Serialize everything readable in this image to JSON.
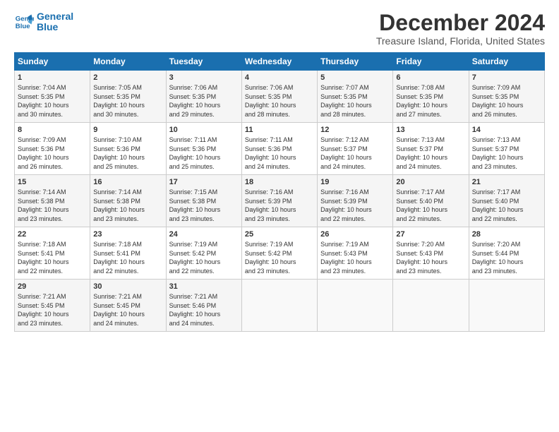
{
  "logo": {
    "line1": "General",
    "line2": "Blue"
  },
  "title": "December 2024",
  "subtitle": "Treasure Island, Florida, United States",
  "headers": [
    "Sunday",
    "Monday",
    "Tuesday",
    "Wednesday",
    "Thursday",
    "Friday",
    "Saturday"
  ],
  "weeks": [
    [
      {
        "day": "1",
        "sunrise": "7:04 AM",
        "sunset": "5:35 PM",
        "daylight": "10 hours and 30 minutes."
      },
      {
        "day": "2",
        "sunrise": "7:05 AM",
        "sunset": "5:35 PM",
        "daylight": "10 hours and 30 minutes."
      },
      {
        "day": "3",
        "sunrise": "7:06 AM",
        "sunset": "5:35 PM",
        "daylight": "10 hours and 29 minutes."
      },
      {
        "day": "4",
        "sunrise": "7:06 AM",
        "sunset": "5:35 PM",
        "daylight": "10 hours and 28 minutes."
      },
      {
        "day": "5",
        "sunrise": "7:07 AM",
        "sunset": "5:35 PM",
        "daylight": "10 hours and 28 minutes."
      },
      {
        "day": "6",
        "sunrise": "7:08 AM",
        "sunset": "5:35 PM",
        "daylight": "10 hours and 27 minutes."
      },
      {
        "day": "7",
        "sunrise": "7:09 AM",
        "sunset": "5:35 PM",
        "daylight": "10 hours and 26 minutes."
      }
    ],
    [
      {
        "day": "8",
        "sunrise": "7:09 AM",
        "sunset": "5:36 PM",
        "daylight": "10 hours and 26 minutes."
      },
      {
        "day": "9",
        "sunrise": "7:10 AM",
        "sunset": "5:36 PM",
        "daylight": "10 hours and 25 minutes."
      },
      {
        "day": "10",
        "sunrise": "7:11 AM",
        "sunset": "5:36 PM",
        "daylight": "10 hours and 25 minutes."
      },
      {
        "day": "11",
        "sunrise": "7:11 AM",
        "sunset": "5:36 PM",
        "daylight": "10 hours and 24 minutes."
      },
      {
        "day": "12",
        "sunrise": "7:12 AM",
        "sunset": "5:37 PM",
        "daylight": "10 hours and 24 minutes."
      },
      {
        "day": "13",
        "sunrise": "7:13 AM",
        "sunset": "5:37 PM",
        "daylight": "10 hours and 24 minutes."
      },
      {
        "day": "14",
        "sunrise": "7:13 AM",
        "sunset": "5:37 PM",
        "daylight": "10 hours and 23 minutes."
      }
    ],
    [
      {
        "day": "15",
        "sunrise": "7:14 AM",
        "sunset": "5:38 PM",
        "daylight": "10 hours and 23 minutes."
      },
      {
        "day": "16",
        "sunrise": "7:14 AM",
        "sunset": "5:38 PM",
        "daylight": "10 hours and 23 minutes."
      },
      {
        "day": "17",
        "sunrise": "7:15 AM",
        "sunset": "5:38 PM",
        "daylight": "10 hours and 23 minutes."
      },
      {
        "day": "18",
        "sunrise": "7:16 AM",
        "sunset": "5:39 PM",
        "daylight": "10 hours and 23 minutes."
      },
      {
        "day": "19",
        "sunrise": "7:16 AM",
        "sunset": "5:39 PM",
        "daylight": "10 hours and 22 minutes."
      },
      {
        "day": "20",
        "sunrise": "7:17 AM",
        "sunset": "5:40 PM",
        "daylight": "10 hours and 22 minutes."
      },
      {
        "day": "21",
        "sunrise": "7:17 AM",
        "sunset": "5:40 PM",
        "daylight": "10 hours and 22 minutes."
      }
    ],
    [
      {
        "day": "22",
        "sunrise": "7:18 AM",
        "sunset": "5:41 PM",
        "daylight": "10 hours and 22 minutes."
      },
      {
        "day": "23",
        "sunrise": "7:18 AM",
        "sunset": "5:41 PM",
        "daylight": "10 hours and 22 minutes."
      },
      {
        "day": "24",
        "sunrise": "7:19 AM",
        "sunset": "5:42 PM",
        "daylight": "10 hours and 22 minutes."
      },
      {
        "day": "25",
        "sunrise": "7:19 AM",
        "sunset": "5:42 PM",
        "daylight": "10 hours and 23 minutes."
      },
      {
        "day": "26",
        "sunrise": "7:19 AM",
        "sunset": "5:43 PM",
        "daylight": "10 hours and 23 minutes."
      },
      {
        "day": "27",
        "sunrise": "7:20 AM",
        "sunset": "5:43 PM",
        "daylight": "10 hours and 23 minutes."
      },
      {
        "day": "28",
        "sunrise": "7:20 AM",
        "sunset": "5:44 PM",
        "daylight": "10 hours and 23 minutes."
      }
    ],
    [
      {
        "day": "29",
        "sunrise": "7:21 AM",
        "sunset": "5:45 PM",
        "daylight": "10 hours and 23 minutes."
      },
      {
        "day": "30",
        "sunrise": "7:21 AM",
        "sunset": "5:45 PM",
        "daylight": "10 hours and 24 minutes."
      },
      {
        "day": "31",
        "sunrise": "7:21 AM",
        "sunset": "5:46 PM",
        "daylight": "10 hours and 24 minutes."
      },
      null,
      null,
      null,
      null
    ]
  ],
  "labels": {
    "sunrise": "Sunrise:",
    "sunset": "Sunset:",
    "daylight": "Daylight:"
  }
}
